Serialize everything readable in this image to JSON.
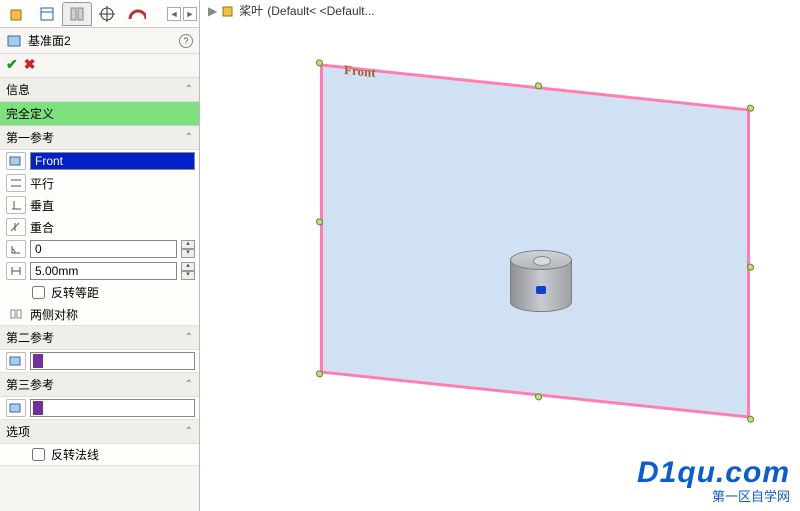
{
  "breadcrumb": {
    "part": "桨叶",
    "config": "(Default< <Default..."
  },
  "feature": {
    "title": "基准面2"
  },
  "sections": {
    "info": "信息",
    "status": "完全定义",
    "ref1": "第一参考",
    "ref2": "第二参考",
    "ref3": "第三参考",
    "options": "选项"
  },
  "ref1": {
    "face": "Front",
    "parallel": "平行",
    "perpendicular": "垂直",
    "coincident": "重合",
    "angle": "0",
    "distance": "5.00mm",
    "flip_offset": "反转等距",
    "mirror": "两侧对称"
  },
  "options": {
    "flip_normal": "反转法线"
  },
  "viewport": {
    "plane_label": "Front"
  },
  "watermark": {
    "domain": "D1qu.com",
    "tagline": "第一区自学网"
  }
}
